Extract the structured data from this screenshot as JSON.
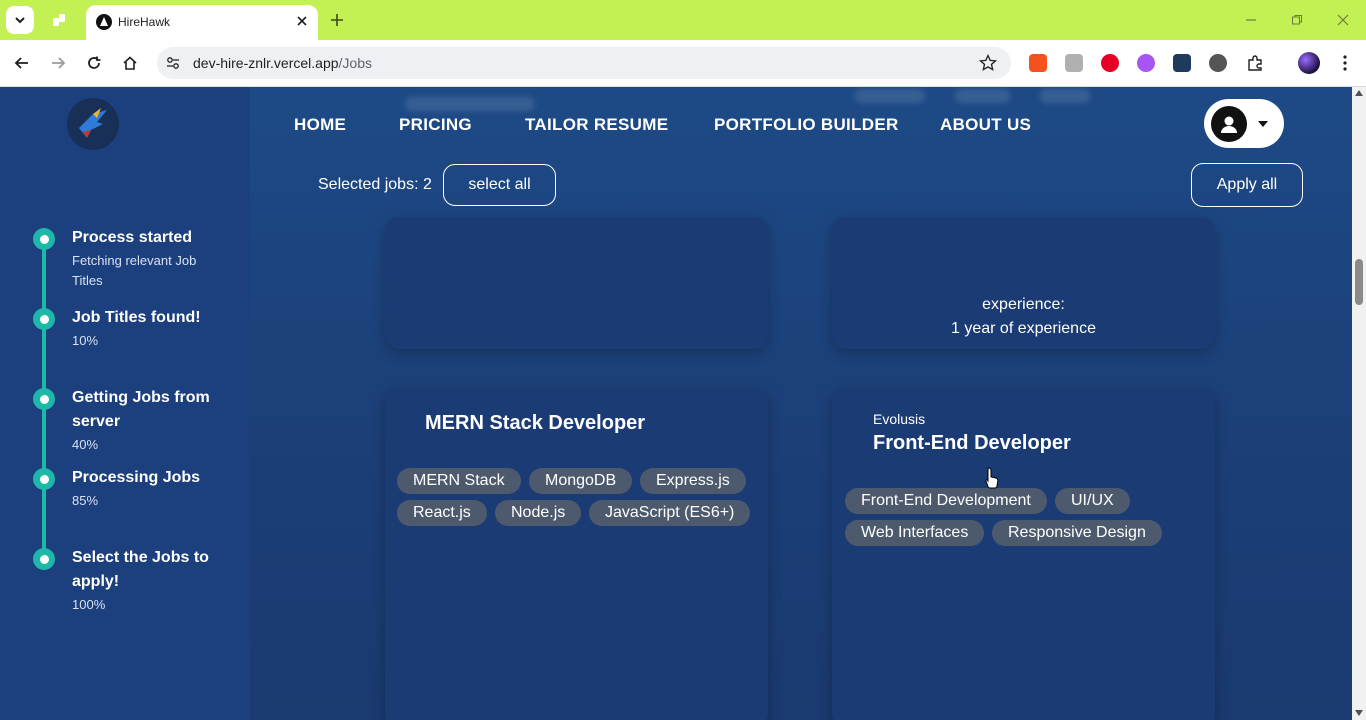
{
  "browser": {
    "tab_title": "HireHawk",
    "url_host": "dev-hire-znlr.vercel.app",
    "url_path": "/Jobs"
  },
  "nav": {
    "items": [
      "HOME",
      "PRICING",
      "TAILOR RESUME",
      "PORTFOLIO BUILDER",
      "ABOUT US"
    ]
  },
  "selection": {
    "label": "Selected jobs: 2",
    "select_all": "select all",
    "apply_all": "Apply all"
  },
  "progress_steps": [
    {
      "title": "Process started",
      "subtitle": "Fetching relevant Job Titles"
    },
    {
      "title": "Job Titles found!",
      "subtitle": "10%"
    },
    {
      "title": "Getting Jobs from server",
      "subtitle": "40%"
    },
    {
      "title": "Processing Jobs",
      "subtitle": "85%"
    },
    {
      "title": "Select the Jobs to apply!",
      "subtitle": "100%"
    }
  ],
  "cards": {
    "top_right": {
      "experience_label": "experience:",
      "experience_value": "1 year of experience"
    },
    "mern": {
      "title": "MERN Stack Developer",
      "tags": [
        "MERN Stack",
        "MongoDB",
        "Express.js",
        "React.js",
        "Node.js",
        "JavaScript (ES6+)"
      ]
    },
    "frontend": {
      "company": "Evolusis",
      "title": "Front-End Developer",
      "tags": [
        "Front-End Development",
        "UI/UX",
        "Web Interfaces",
        "Responsive Design"
      ]
    }
  },
  "colors": {
    "tab_strip": "#c3f053",
    "page_bg": "#1c3f78",
    "accent_teal": "#1fb8a8",
    "tag_bg": "#4d5a6e"
  }
}
